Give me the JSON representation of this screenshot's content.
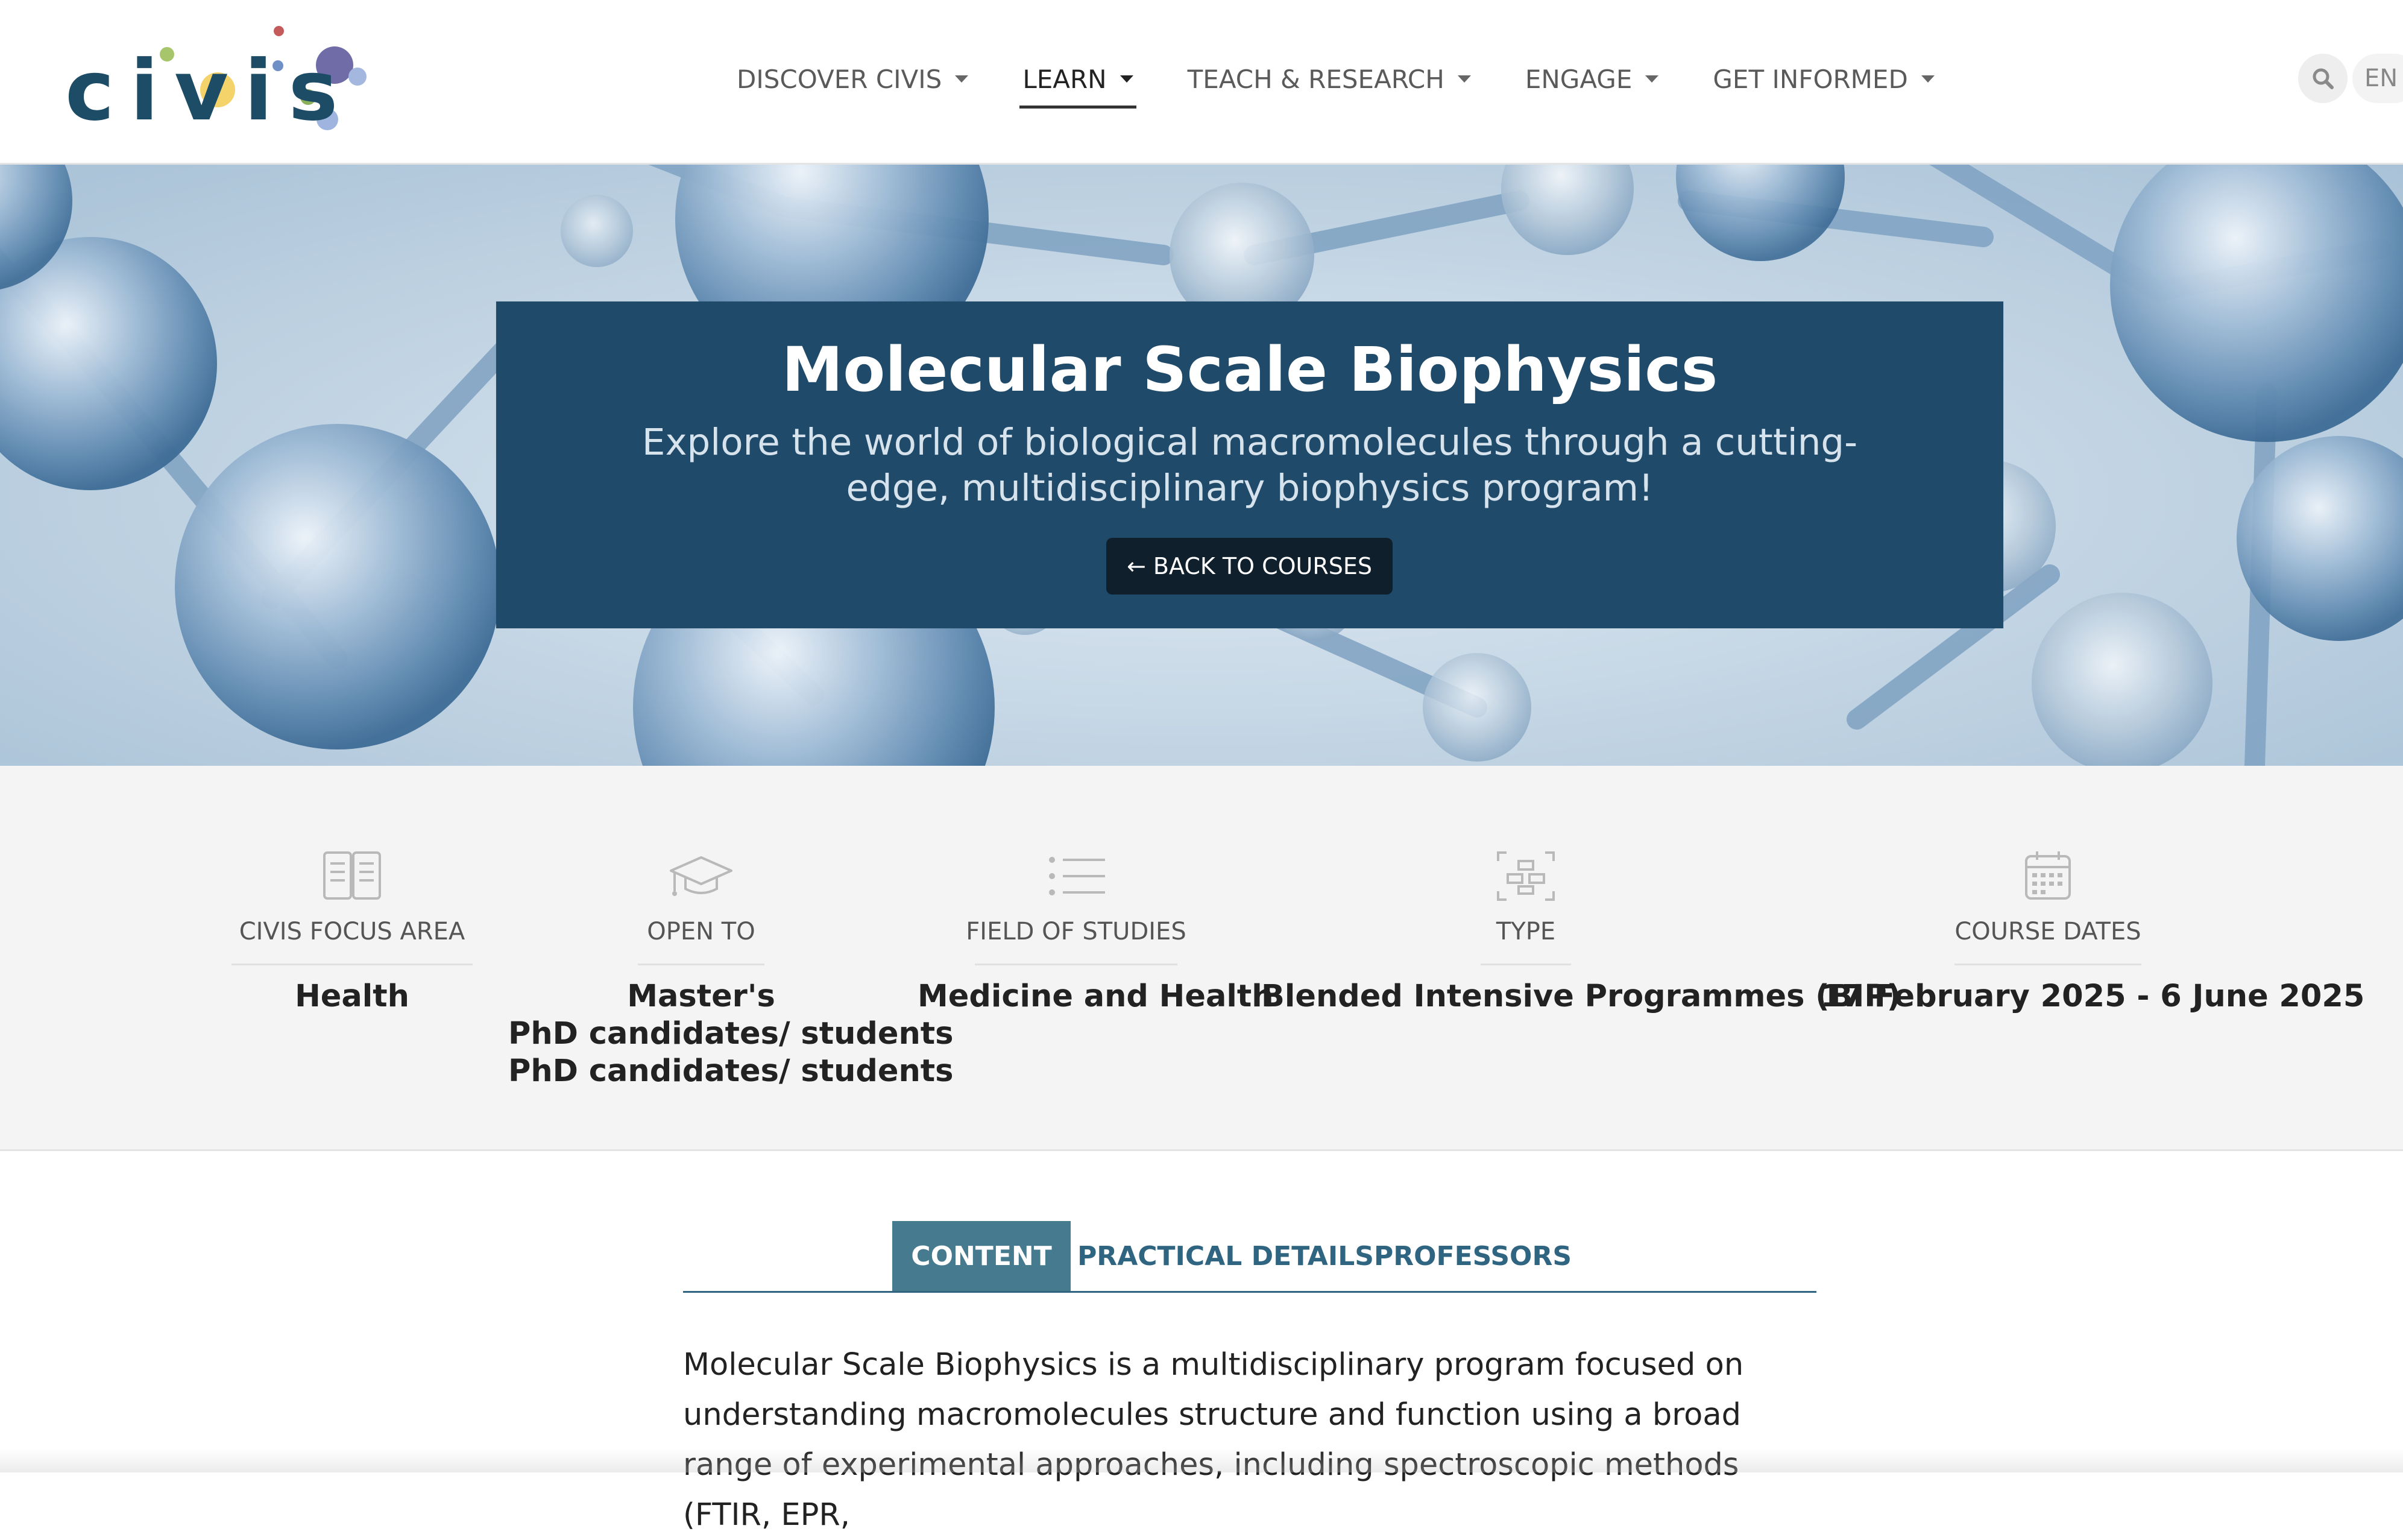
{
  "header": {
    "logo_text": "civis",
    "nav": [
      {
        "label": "DISCOVER CIVIS"
      },
      {
        "label": "LEARN"
      },
      {
        "label": "TEACH & RESEARCH"
      },
      {
        "label": "ENGAGE"
      },
      {
        "label": "GET INFORMED"
      }
    ],
    "active_nav": "LEARN",
    "language": "EN"
  },
  "hero": {
    "title": "Molecular Scale Biophysics",
    "subtitle": "Explore the world of biological macromolecules through a cutting-edge, multidisciplinary biophysics program!",
    "back_button": "← BACK TO COURSES"
  },
  "info": {
    "focus_area": {
      "label": "CIVIS FOCUS AREA",
      "value": "Health"
    },
    "open_to": {
      "label": "OPEN TO",
      "values": [
        "Master's",
        "PhD candidates/ students",
        "PhD candidates/ students"
      ]
    },
    "field": {
      "label": "FIELD OF STUDIES",
      "value": "Medicine and Health"
    },
    "type": {
      "label": "TYPE",
      "value": "Blended Intensive Programmes (BIP)"
    },
    "dates": {
      "label": "COURSE DATES",
      "value": "17 February 2025 - 6 June 2025"
    }
  },
  "tabs": [
    {
      "label": "CONTENT"
    },
    {
      "label": "PRACTICAL DETAILS"
    },
    {
      "label": "PROFESSORS"
    }
  ],
  "content": {
    "intro": "Molecular Scale Biophysics is a multidisciplinary program focused on understanding macromolecules structure and function using a broad range of experimental approaches, including spectroscopic methods (FTIR, EPR,"
  },
  "colors": {
    "brand_navy": "#1f4a69",
    "tab_active": "#457a8f",
    "tab_text": "#2f6581"
  }
}
